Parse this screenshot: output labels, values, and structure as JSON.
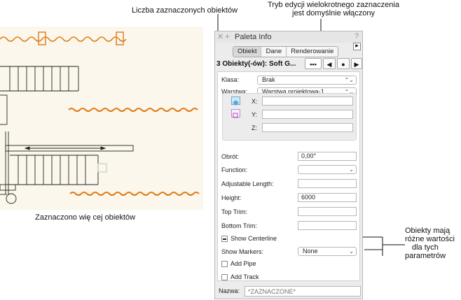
{
  "callouts": {
    "selected_count": "Liczba zaznaczonych obiektów",
    "multi_edit_line1": "Tryb edycji wielokrotnego zaznaczenia",
    "multi_edit_line2": "jest domyślnie włączony",
    "different_values_line1": "Obiekty mają",
    "different_values_line2": "różne wartości",
    "different_values_line3": "dla tych",
    "different_values_line4": "parametrów",
    "drawing_caption": "Zaznaczono wię cej obiektów"
  },
  "palette": {
    "title": "Paleta Info",
    "tabs": [
      {
        "label": "Obiekt",
        "selected": true
      },
      {
        "label": "Dane",
        "selected": false
      },
      {
        "label": "Renderowanie",
        "selected": false
      }
    ],
    "selection_label": "3 Obiekty(-ów): Soft G...",
    "nav": {
      "multi": "•••",
      "prev": "◀",
      "current": "●",
      "next": "▶"
    },
    "class_label": "Klasa:",
    "class_value": "Brak",
    "layer_label": "Warstwa:",
    "layer_value": "Warstwa projektowa-1",
    "x_label": "X:",
    "y_label": "Y:",
    "z_label": "Z:",
    "x_value": "",
    "y_value": "",
    "z_value": "",
    "rotation_label": "Obrót:",
    "rotation_value": "0,00°",
    "function_label": "Function:",
    "function_value": "",
    "adj_length_label": "Adjustable Length:",
    "adj_length_value": "",
    "height_label": "Height:",
    "height_value": "6000",
    "top_trim_label": "Top Trim:",
    "top_trim_value": "",
    "bottom_trim_label": "Bottom Trim:",
    "bottom_trim_value": "",
    "show_centerline_label": "Show Centerline",
    "show_markers_label": "Show Markers:",
    "show_markers_value": "None",
    "add_pipe_label": "Add Pipe",
    "add_track_label": "Add Track",
    "name_label": "Nazwa:",
    "name_placeholder": "*ZAZNACZONE*"
  },
  "colors": {
    "accent_orange": "#e07a16",
    "drawing_bg": "#fbf7ec"
  }
}
